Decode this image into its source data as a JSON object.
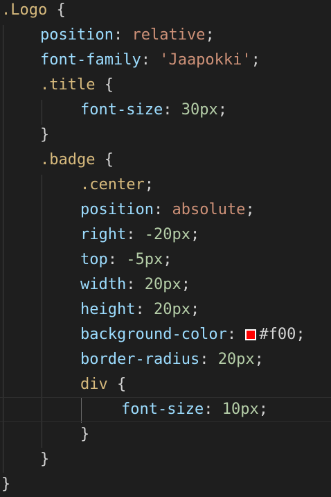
{
  "editor": {
    "theme": {
      "background": "#1e1e1e",
      "selector_color": "#d7ba7d",
      "property_color": "#9cdcfe",
      "string_value_color": "#ce9178",
      "number_value_color": "#b5cea8"
    },
    "lines": [
      {
        "selector": ".Logo",
        "open": " {"
      },
      {
        "prop": "position",
        "sep": ": ",
        "value": "relative",
        "end": ";"
      },
      {
        "prop": "font-family",
        "sep": ": ",
        "value": "'Jaapokki'",
        "end": ";"
      },
      {
        "selector": ".title",
        "open": " {"
      },
      {
        "prop": "font-size",
        "sep": ": ",
        "value": "30px",
        "end": ";"
      },
      {
        "close": "}"
      },
      {
        "selector": ".badge",
        "open": " {"
      },
      {
        "selector": ".center",
        "end": ";"
      },
      {
        "prop": "position",
        "sep": ": ",
        "value": "absolute",
        "end": ";"
      },
      {
        "prop": "right",
        "sep": ": ",
        "value": "-20px",
        "end": ";"
      },
      {
        "prop": "top",
        "sep": ": ",
        "value": "-5px",
        "end": ";"
      },
      {
        "prop": "width",
        "sep": ": ",
        "value": "20px",
        "end": ";"
      },
      {
        "prop": "height",
        "sep": ": ",
        "value": "20px",
        "end": ";"
      },
      {
        "prop": "background-color",
        "sep": ": ",
        "value": "#f00",
        "end": ";",
        "swatch": "#ff0000"
      },
      {
        "prop": "border-radius",
        "sep": ": ",
        "value": "20px",
        "end": ";"
      },
      {
        "selector": "div",
        "open": " {"
      },
      {
        "prop": "font-size",
        "sep": ": ",
        "value": "10px",
        "end": ";"
      },
      {
        "close": "}"
      },
      {
        "close": "}"
      },
      {
        "close": "}"
      }
    ]
  }
}
